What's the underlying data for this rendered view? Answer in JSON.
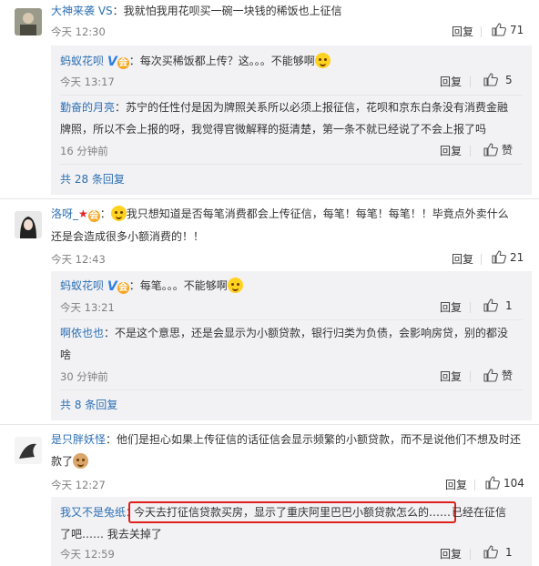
{
  "actions": {
    "reply": "回复",
    "like": "赞"
  },
  "comments": [
    {
      "user": "大神来袭 VS",
      "colon": "：",
      "text": "我就怕我用花呗买一碗一块钱的稀饭也上征信",
      "time": "今天 12:30",
      "likes": "71",
      "replies": [
        {
          "user": "蚂蚁花呗",
          "colon": "：",
          "text": "每次买稀饭都上传？这。。。不能够啊",
          "time": "今天 13:17",
          "likes": "5"
        },
        {
          "user": "勤奋的月亮",
          "colon": "：",
          "text_lines": [
            "苏宁的任性付是因为牌照关系所以必须上报征信，花呗和京东白条没有消费金融",
            "牌照，所以不会上报的呀，我觉得官微解释的挺清楚，第一条不就已经说了不会上报了吗"
          ],
          "time": "16 分钟前",
          "likes": "赞"
        }
      ],
      "more": "共 28 条回复"
    },
    {
      "user": "洛呀_",
      "colon": "：",
      "text_lines": [
        "我只想知道是否每笔消费都会上传征信，每笔！每笔！每笔！！毕竟点外卖什么",
        "还是会造成很多小额消费的！！"
      ],
      "time": "今天 12:43",
      "likes": "21",
      "replies": [
        {
          "user": "蚂蚁花呗",
          "colon": "：",
          "text": "每笔。。。不能够啊",
          "time": "今天 13:21",
          "likes": "1"
        },
        {
          "user": "啊依也也",
          "colon": "：",
          "text_lines": [
            "不是这个意思，还是会显示为小额贷款，银行归类为负债，会影响房贷，别的都没",
            "啥"
          ],
          "time": "30 分钟前",
          "likes": "赞"
        }
      ],
      "more": "共 8 条回复"
    },
    {
      "user": "是只胖妖怪",
      "colon": "：",
      "text_lines": [
        "他们是担心如果上传征信的话征信会显示频繁的小额贷款，而不是说他们不想及时还",
        "款了"
      ],
      "time": "今天 12:27",
      "likes": "104",
      "replies": [
        {
          "user": "我又不是兔纸",
          "colon": "：",
          "highlight": "今天去打征信贷款买房，显示了重庆阿里巴巴小额贷款怎么的……",
          "text_rest": "已经在征信",
          "text_line2": "了吧…… 我去关掉了",
          "time": "今天 12:59",
          "likes": "1"
        }
      ]
    }
  ],
  "colors": {
    "link": "#2c6fb3",
    "highlight_border": "#e0201a",
    "reply_bg": "#f2f2f5"
  },
  "icons": [
    "reply",
    "thumb-up-icon",
    "v-verified-badge",
    "emoji"
  ]
}
